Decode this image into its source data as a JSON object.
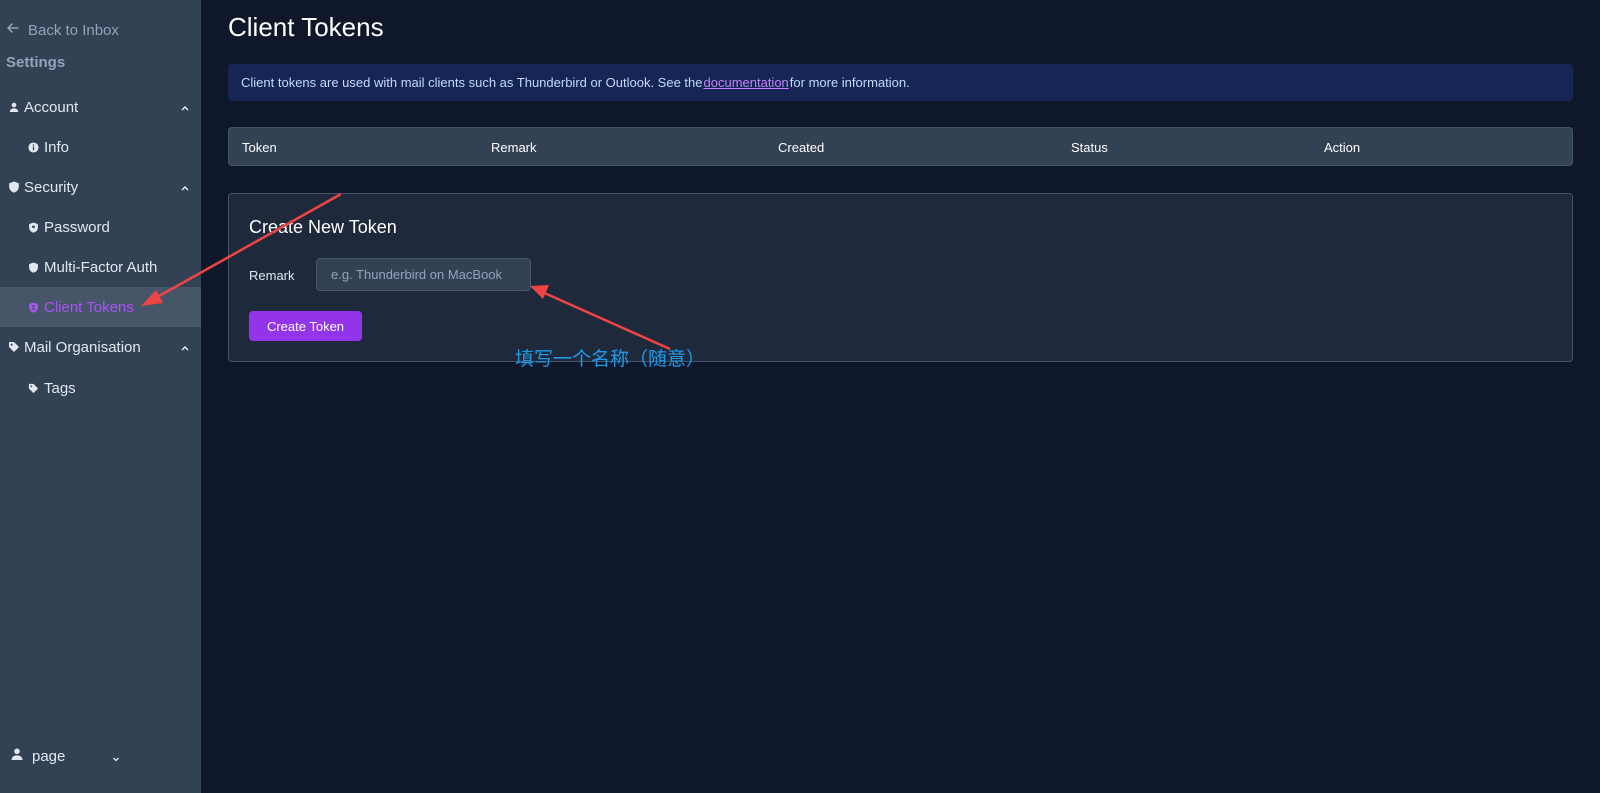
{
  "sidebar": {
    "back_label": "Back to Inbox",
    "settings_title": "Settings",
    "groups": [
      {
        "label": "Account",
        "icon": "person-icon",
        "items": [
          {
            "label": "Info",
            "icon": "info-icon"
          }
        ]
      },
      {
        "label": "Security",
        "icon": "shield-icon",
        "items": [
          {
            "label": "Password",
            "icon": "shield-icon"
          },
          {
            "label": "Multi-Factor Auth",
            "icon": "shield-icon"
          },
          {
            "label": "Client Tokens",
            "icon": "shield-person-icon",
            "active": true
          }
        ]
      },
      {
        "label": "Mail Organisation",
        "icon": "tag-icon",
        "items": [
          {
            "label": "Tags",
            "icon": "tag-icon"
          }
        ]
      }
    ],
    "user_label": "page"
  },
  "main": {
    "title": "Client Tokens",
    "banner": {
      "before": "Client tokens are used with mail clients such as Thunderbird or Outlook. See the",
      "link": "documentation",
      "after": "for more information."
    },
    "table": {
      "columns": [
        "Token",
        "Remark",
        "Created",
        "Status",
        "Action"
      ]
    },
    "create_card": {
      "title": "Create New Token",
      "remark_label": "Remark",
      "remark_placeholder": "e.g. Thunderbird on MacBook",
      "remark_value": "",
      "button_label": "Create Token"
    }
  },
  "annotation": {
    "text": "填写一个名称（随意）",
    "color": "#1e9be8",
    "arrow_color": "#ef4444"
  },
  "colors": {
    "accent": "#9333ea",
    "active_text": "#a855f7",
    "sidebar_bg": "#334155",
    "page_bg": "#0f172a"
  }
}
